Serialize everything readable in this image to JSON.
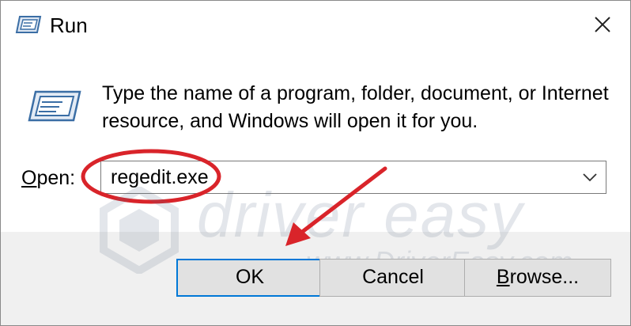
{
  "window": {
    "title": "Run",
    "close_icon": "close-icon",
    "app_icon": "run-dialog-icon"
  },
  "dialog": {
    "description_line1": "Type the name of a program, folder, document, or Internet",
    "description_line2": "resource, and Windows will open it for you.",
    "open_label_accel": "O",
    "open_label_rest": "pen:",
    "open_value": "regedit.exe",
    "dropdown_icon": "chevron-down-icon"
  },
  "buttons": {
    "ok": "OK",
    "cancel": "Cancel",
    "browse_accel": "B",
    "browse_rest": "rowse..."
  },
  "watermark": {
    "logo": "driver easy",
    "url": "www.DriverEasy.com"
  },
  "annotations": {
    "highlight_color": "#d9242a",
    "arrow_color": "#d9242a"
  },
  "colors": {
    "footer_bg": "#f0f0f0",
    "default_button_border": "#0078d7",
    "button_bg": "#e1e1e1"
  }
}
